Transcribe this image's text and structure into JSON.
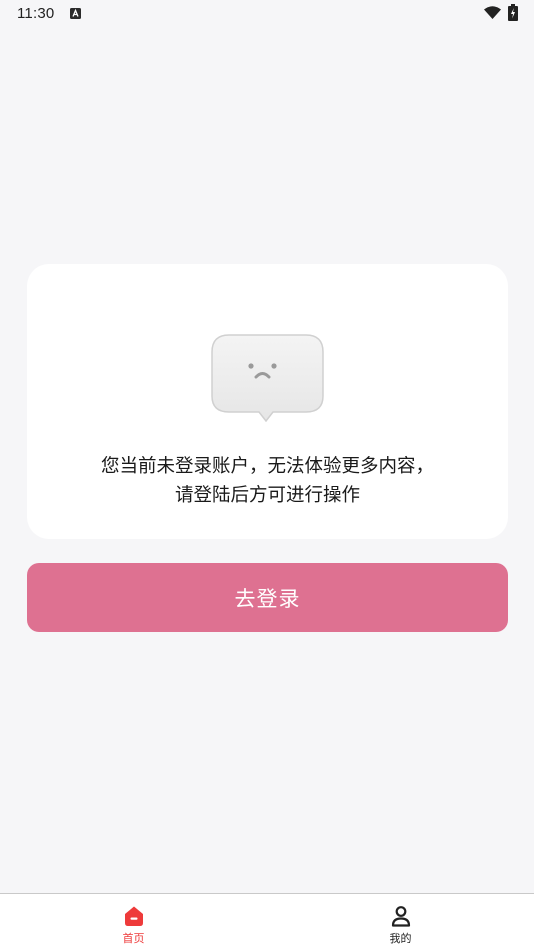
{
  "status_bar": {
    "time": "11:30",
    "notification_icon": "a-square-icon",
    "wifi_icon": "wifi-icon",
    "battery_icon": "battery-charging-icon"
  },
  "notice": {
    "icon": "sad-speech-bubble-icon",
    "line1": "您当前未登录账户，无法体验更多内容，",
    "line2": "请登陆后方可进行操作"
  },
  "login_button": {
    "label": "去登录",
    "color": "#de7191"
  },
  "bottom_nav": {
    "active_color": "#ee3a3a",
    "items": [
      {
        "label": "首页",
        "icon": "home-icon",
        "active": true
      },
      {
        "label": "我的",
        "icon": "user-icon",
        "active": false
      }
    ]
  }
}
